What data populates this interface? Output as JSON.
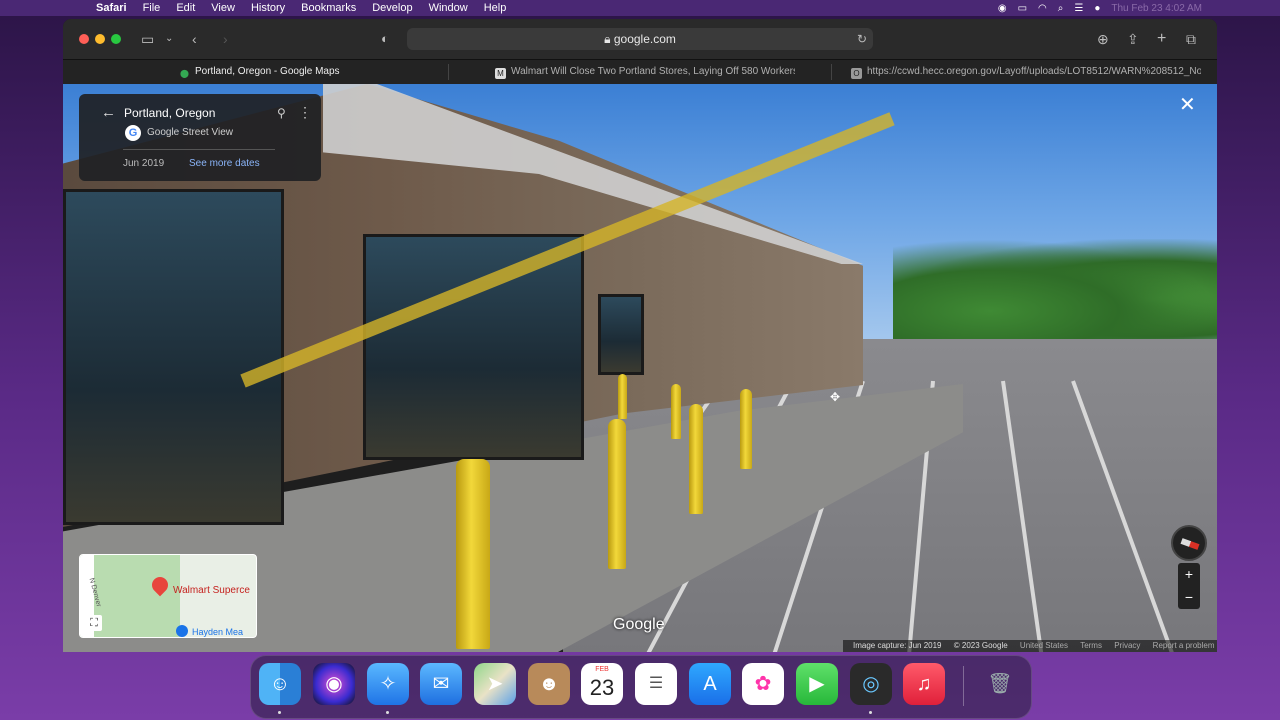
{
  "menubar": {
    "apple": "",
    "app_name": "Safari",
    "menus": [
      "File",
      "Edit",
      "View",
      "History",
      "Bookmarks",
      "Develop",
      "Window",
      "Help"
    ],
    "clock": "Thu Feb 23 4:02 AM"
  },
  "browser": {
    "url": "google.com",
    "tabs": [
      {
        "label": "Portland, Oregon - Google Maps",
        "active": true
      },
      {
        "label": "Walmart Will Close Two Portland Stores, Laying Off 580 Workers",
        "active": false
      },
      {
        "label": "https://ccwd.hecc.oregon.gov/Layoff/uploads/LOT8512/WARN%208512_Notice...",
        "active": false
      }
    ]
  },
  "streetview": {
    "location_title": "Portland, Oregon",
    "service": "Google Street View",
    "capture_month": "Jun 2019",
    "see_more_dates": "See more dates",
    "minimap": {
      "place_label": "Walmart Superce",
      "street_label": "N Denver",
      "secondary_label": "Hayden Mea"
    },
    "watermark": "Google",
    "footer": {
      "capture": "Image capture: Jun 2019",
      "copyright": "© 2023 Google",
      "country": "United States",
      "terms": "Terms",
      "privacy": "Privacy",
      "report": "Report a problem"
    },
    "zoom_in": "+",
    "zoom_out": "−"
  },
  "dock": {
    "calendar_month": "FEB",
    "calendar_day": "23"
  }
}
